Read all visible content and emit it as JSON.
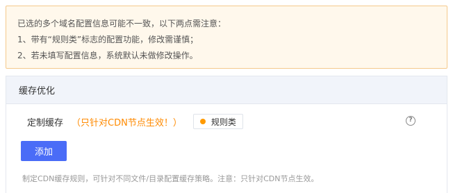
{
  "notice": {
    "lines": [
      "已选的多个域名配置信息可能不一致，以下两点需注意：",
      "1、带有“规则类”标志的配置功能，修改需谨慎；",
      "2、若未填写配置信息，系统默认未做修改操作。"
    ]
  },
  "panel": {
    "title": "缓存优化",
    "row_label": "定制缓存",
    "row_note": "（只针对CDN节点生效！）",
    "badge_label": "规则类",
    "help_icon": "question-circle-icon",
    "add_button": "添加",
    "description": "制定CDN缓存规则，可针对不同文件/目录配置缓存策略。注意：只针对CDN节点生效。"
  },
  "colors": {
    "accent": "#4a6cf7",
    "warning_text": "#ff8a00",
    "badge_dot": "#ff9a00",
    "notice_bg": "#fff8ec",
    "notice_border": "#f5c98b"
  }
}
